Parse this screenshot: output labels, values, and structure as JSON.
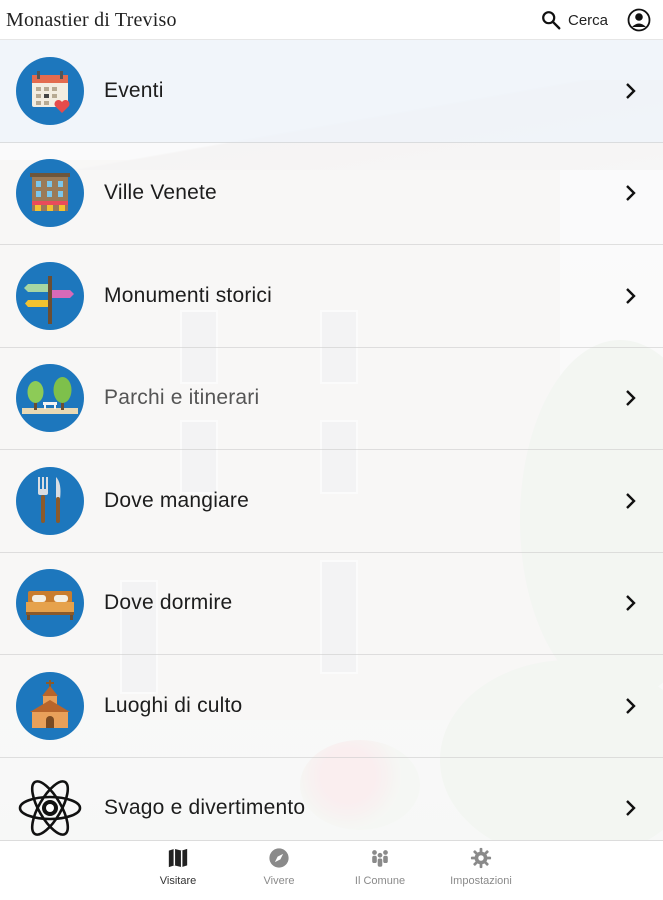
{
  "header": {
    "title": "Monastier di Treviso",
    "search_label": "Cerca",
    "search_icon": "search-icon",
    "profile_icon": "user-profile-icon"
  },
  "menu": {
    "items": [
      {
        "label": "Eventi",
        "icon": "calendar-heart-icon"
      },
      {
        "label": "Ville Venete",
        "icon": "villa-building-icon"
      },
      {
        "label": "Monumenti storici",
        "icon": "signpost-icon"
      },
      {
        "label": "Parchi e itinerari",
        "icon": "park-trees-bench-icon"
      },
      {
        "label": "Dove mangiare",
        "icon": "fork-knife-icon"
      },
      {
        "label": "Dove dormire",
        "icon": "bed-icon"
      },
      {
        "label": "Luoghi di culto",
        "icon": "church-icon"
      },
      {
        "label": "Svago e divertimento",
        "icon": "atom-icon"
      }
    ]
  },
  "tabbar": {
    "tabs": [
      {
        "label": "Visitare",
        "icon": "map-icon",
        "active": true
      },
      {
        "label": "Vivere",
        "icon": "compass-icon",
        "active": false
      },
      {
        "label": "Il Comune",
        "icon": "people-icon",
        "active": false
      },
      {
        "label": "Impostazioni",
        "icon": "gear-icon",
        "active": false
      }
    ]
  },
  "colors": {
    "icon_circle": "#1d77bd",
    "first_row_highlight": "#eef3fa",
    "tab_active": "#333333",
    "tab_inactive": "#8a8a8a"
  }
}
